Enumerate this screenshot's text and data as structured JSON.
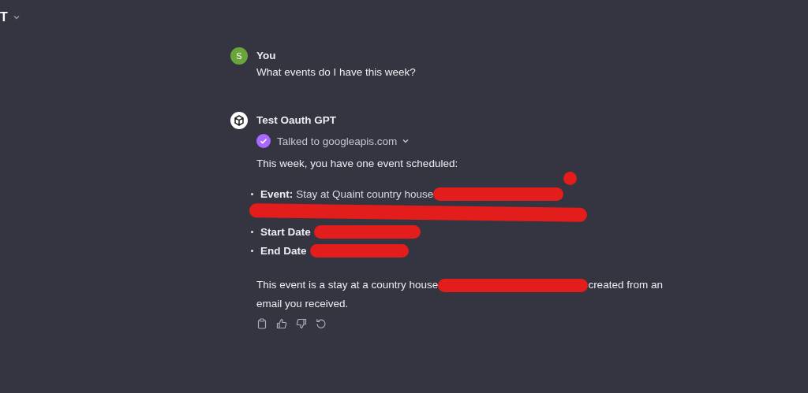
{
  "header": {
    "model_name": "T"
  },
  "messages": [
    {
      "kind": "user",
      "avatar_letter": "S",
      "author": "You",
      "text": "What events do I have this week?"
    },
    {
      "kind": "assistant",
      "author": "Test Oauth GPT",
      "tool": {
        "label": "Talked to googleapis.com",
        "done": true
      },
      "intro": "This week, you have one event scheduled:",
      "items": [
        {
          "kind": "field",
          "label": "Event:",
          "value": "Stay at Quaint country house",
          "redacted": true,
          "dot": true
        },
        {
          "kind": "redacted"
        },
        {
          "kind": "field",
          "label": "Start Date",
          "redacted": true,
          "dot": false
        },
        {
          "kind": "field",
          "label": "End Date",
          "redacted": true,
          "dot": false
        }
      ],
      "summary_before": "This event is a stay at a country house",
      "summary_after": "created from an",
      "summary_end": "email you received."
    }
  ]
}
